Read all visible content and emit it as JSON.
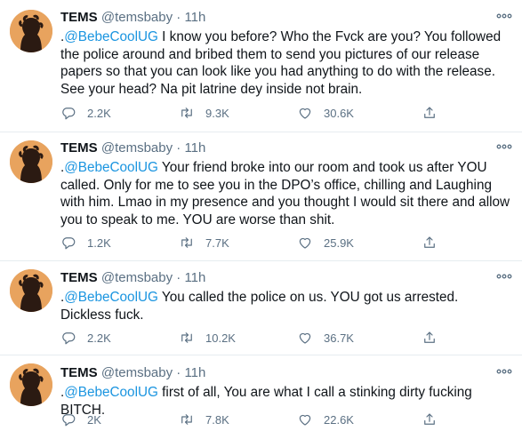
{
  "tweets": [
    {
      "name": "TEMS",
      "handle": "@temsbaby",
      "time": "11h",
      "prefix": ".",
      "mention": "@BebeCoolUG",
      "text": " I know you before? Who the Fvck are you? You followed the police around and bribed them to send you pictures of our release papers so that you can look like you had anything to do with the release. See your head? Na pit latrine dey inside not brain.",
      "replies": "2.2K",
      "retweets": "9.3K",
      "likes": "30.6K"
    },
    {
      "name": "TEMS",
      "handle": "@temsbaby",
      "time": "11h",
      "prefix": ".",
      "mention": "@BebeCoolUG",
      "text": " Your friend broke into our room and took us after YOU called. Only for me to see you in the DPO’s office, chilling and Laughing with him. Lmao in my presence and you thought I would sit there and allow you to speak to me. YOU are worse than shit.",
      "replies": "1.2K",
      "retweets": "7.7K",
      "likes": "25.9K"
    },
    {
      "name": "TEMS",
      "handle": "@temsbaby",
      "time": "11h",
      "prefix": ".",
      "mention": "@BebeCoolUG",
      "text": " You called the police on us. YOU got us arrested. Dickless fuck.",
      "replies": "2.2K",
      "retweets": "10.2K",
      "likes": "36.7K"
    },
    {
      "name": "TEMS",
      "handle": "@temsbaby",
      "time": "11h",
      "prefix": ".",
      "mention": "@BebeCoolUG",
      "text": " first of all, You are what I call a stinking dirty fucking BITCH.",
      "replies": "2K",
      "retweets": "7.8K",
      "likes": "22.6K"
    }
  ],
  "separator": "·",
  "colors": {
    "accent": "#1b95e0",
    "muted": "#5b7083",
    "avatar_bg": "#e8a35e"
  },
  "icons": {
    "reply": "reply-icon",
    "retweet": "retweet-icon",
    "like": "heart-icon",
    "share": "share-icon",
    "more": "more-icon"
  }
}
